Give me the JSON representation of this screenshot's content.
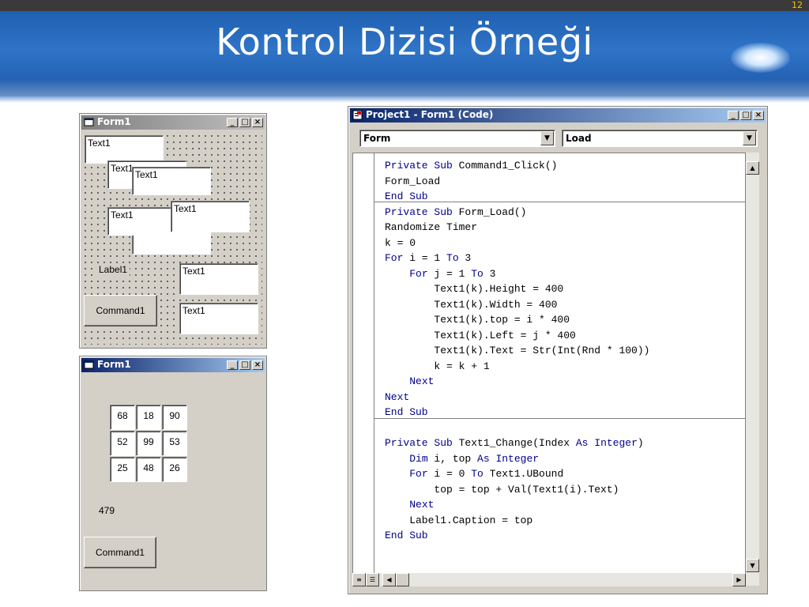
{
  "slide": {
    "number": "12",
    "title": "Kontrol Dizisi Örneği"
  },
  "form_design": {
    "title": "Form1",
    "controls": {
      "text_a": "Text1",
      "text_b": "Text1",
      "text_c": "Text1",
      "text_d": "Text1",
      "text_e": "Text1",
      "text_f": "Text1",
      "text_g": "Text1",
      "label": "Label1",
      "button": "Command1"
    }
  },
  "form_run": {
    "title": "Form1",
    "grid": [
      [
        "68",
        "18",
        "90"
      ],
      [
        "52",
        "99",
        "53"
      ],
      [
        "25",
        "48",
        "26"
      ]
    ],
    "sum_label": "479",
    "button": "Command1"
  },
  "code_window": {
    "title": "Project1 - Form1 (Code)",
    "object_combo": "Form",
    "procedure_combo": "Load",
    "icons": {
      "title_icon": "vb-code-icon",
      "form_icon": "form-icon"
    }
  },
  "window_buttons": {
    "minimize": "_",
    "maximize": "□",
    "close": "×"
  },
  "code": [
    [
      {
        "k": true,
        "t": "Private Sub"
      },
      {
        "k": false,
        "t": " Command1_Click()"
      }
    ],
    [
      {
        "k": false,
        "t": "Form_Load"
      }
    ],
    [
      {
        "k": true,
        "t": "End Sub"
      }
    ],
    [
      {
        "k": true,
        "t": "Private Sub"
      },
      {
        "k": false,
        "t": " Form_Load()"
      }
    ],
    [
      {
        "k": false,
        "t": "Randomize Timer"
      }
    ],
    [
      {
        "k": false,
        "t": "k = 0"
      }
    ],
    [
      {
        "k": true,
        "t": "For"
      },
      {
        "k": false,
        "t": " i = 1 "
      },
      {
        "k": true,
        "t": "To"
      },
      {
        "k": false,
        "t": " 3"
      }
    ],
    [
      {
        "k": false,
        "t": "    "
      },
      {
        "k": true,
        "t": "For"
      },
      {
        "k": false,
        "t": " j = 1 "
      },
      {
        "k": true,
        "t": "To"
      },
      {
        "k": false,
        "t": " 3"
      }
    ],
    [
      {
        "k": false,
        "t": "        Text1(k).Height = 400"
      }
    ],
    [
      {
        "k": false,
        "t": "        Text1(k).Width = 400"
      }
    ],
    [
      {
        "k": false,
        "t": "        Text1(k).top = i * 400"
      }
    ],
    [
      {
        "k": false,
        "t": "        Text1(k).Left = j * 400"
      }
    ],
    [
      {
        "k": false,
        "t": "        Text1(k).Text = Str(Int(Rnd * 100))"
      }
    ],
    [
      {
        "k": false,
        "t": "        k = k + 1"
      }
    ],
    [
      {
        "k": false,
        "t": "    "
      },
      {
        "k": true,
        "t": "Next"
      }
    ],
    [
      {
        "k": true,
        "t": "Next"
      }
    ],
    [
      {
        "k": true,
        "t": "End Sub"
      }
    ],
    [
      {
        "k": false,
        "t": ""
      }
    ],
    [
      {
        "k": true,
        "t": "Private Sub"
      },
      {
        "k": false,
        "t": " Text1_Change(Index "
      },
      {
        "k": true,
        "t": "As Integer"
      },
      {
        "k": false,
        "t": ")"
      }
    ],
    [
      {
        "k": false,
        "t": "    "
      },
      {
        "k": true,
        "t": "Dim"
      },
      {
        "k": false,
        "t": " i, top "
      },
      {
        "k": true,
        "t": "As Integer"
      }
    ],
    [
      {
        "k": false,
        "t": "    "
      },
      {
        "k": true,
        "t": "For"
      },
      {
        "k": false,
        "t": " i = 0 "
      },
      {
        "k": true,
        "t": "To"
      },
      {
        "k": false,
        "t": " Text1.UBound"
      }
    ],
    [
      {
        "k": false,
        "t": "        top = top + Val(Text1(i).Text)"
      }
    ],
    [
      {
        "k": false,
        "t": "    "
      },
      {
        "k": true,
        "t": "Next"
      }
    ],
    [
      {
        "k": false,
        "t": "    Label1.Caption = top"
      }
    ],
    [
      {
        "k": true,
        "t": "End Sub"
      }
    ]
  ]
}
